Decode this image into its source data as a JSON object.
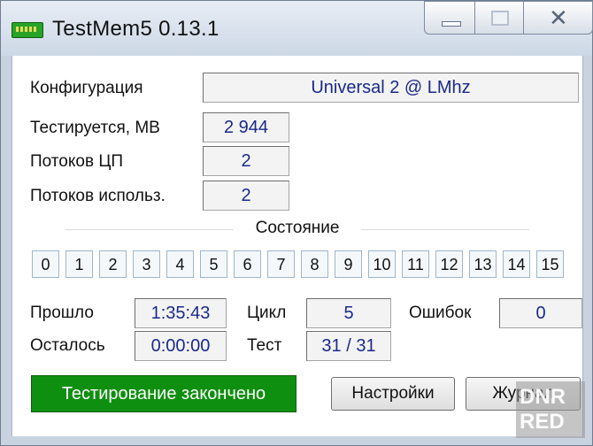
{
  "window": {
    "title": "TestMem5  0.13.1",
    "close_glyph": "✕"
  },
  "config": {
    "configuration_label": "Конфигурация",
    "configuration_value": "Universal 2 @ LMhz",
    "tested_label": "Тестируется, MB",
    "tested_value": "2 944",
    "cpu_threads_label": "Потоков ЦП",
    "cpu_threads_value": "2",
    "used_threads_label": "Потоков использ.",
    "used_threads_value": "2"
  },
  "state": {
    "title": "Состояние",
    "slots": [
      "0",
      "1",
      "2",
      "3",
      "4",
      "5",
      "6",
      "7",
      "8",
      "9",
      "10",
      "11",
      "12",
      "13",
      "14",
      "15"
    ]
  },
  "stats": {
    "elapsed_label": "Прошло",
    "elapsed_value": "1:35:43",
    "remaining_label": "Осталось",
    "remaining_value": "0:00:00",
    "cycle_label": "Цикл",
    "cycle_value": "5",
    "test_label": "Тест",
    "test_value": "31 / 31",
    "errors_label": "Ошибок",
    "errors_value": "0"
  },
  "footer": {
    "status_text": "Тестирование закончено",
    "settings_button": "Настройки",
    "log_button": "Журнал"
  },
  "watermark": {
    "line1": "DNR",
    "line2": "RED"
  },
  "colors": {
    "status_green": "#0f8f0f",
    "value_text": "#1b2a8c"
  }
}
